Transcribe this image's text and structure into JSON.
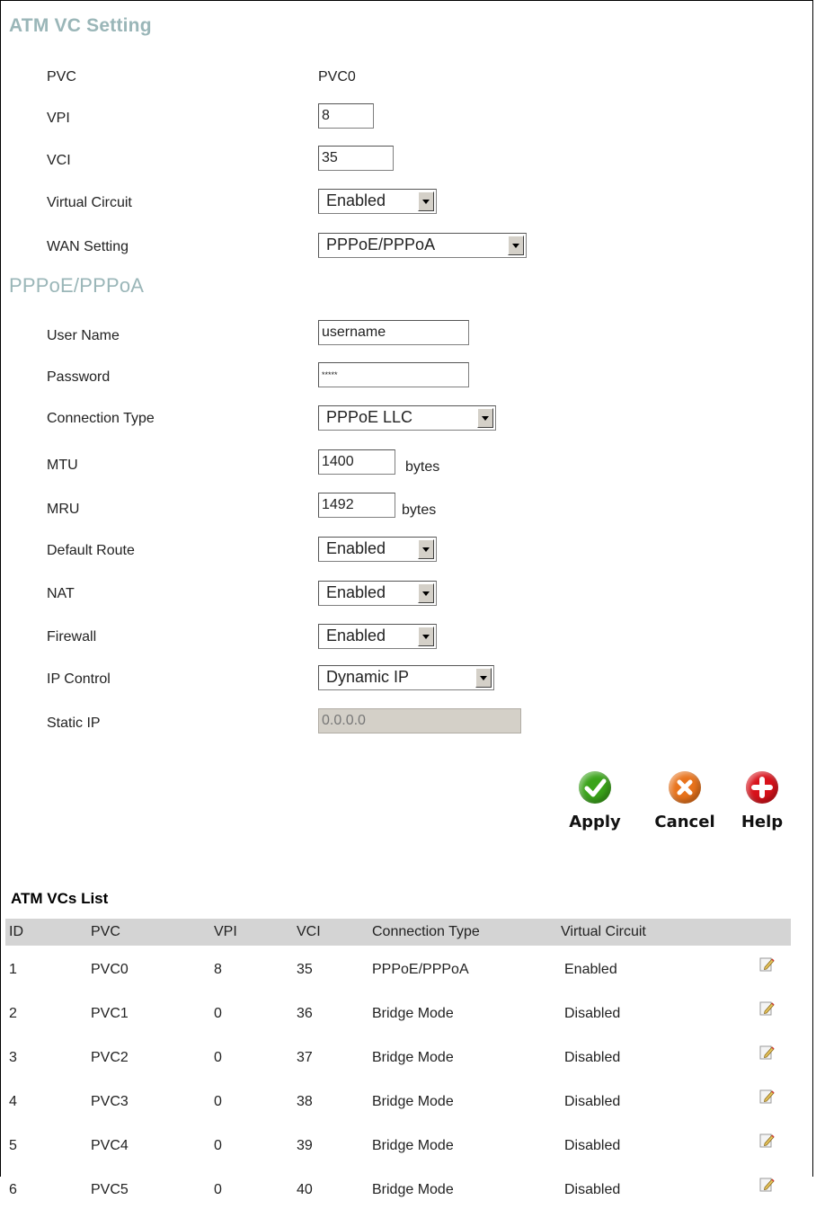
{
  "atm_vc_setting": {
    "title": "ATM VC Setting",
    "pvc": {
      "label": "PVC",
      "value": "PVC0"
    },
    "vpi": {
      "label": "VPI",
      "value": "8"
    },
    "vci": {
      "label": "VCI",
      "value": "35"
    },
    "virtual_circuit": {
      "label": "Virtual Circuit",
      "value": "Enabled"
    },
    "wan_setting": {
      "label": "WAN Setting",
      "value": "PPPoE/PPPoA"
    }
  },
  "pppoe": {
    "title": "PPPoE/PPPoA",
    "user_name": {
      "label": "User Name",
      "value": "username"
    },
    "password": {
      "label": "Password",
      "value": "*****"
    },
    "connection_type": {
      "label": "Connection Type",
      "value": "PPPoE LLC"
    },
    "mtu": {
      "label": "MTU",
      "value": "1400",
      "unit": "bytes"
    },
    "mru": {
      "label": "MRU",
      "value": "1492",
      "unit": "bytes"
    },
    "default_route": {
      "label": "Default Route",
      "value": "Enabled"
    },
    "nat": {
      "label": "NAT",
      "value": "Enabled"
    },
    "firewall": {
      "label": "Firewall",
      "value": "Enabled"
    },
    "ip_control": {
      "label": "IP Control",
      "value": "Dynamic IP"
    },
    "static_ip": {
      "label": "Static IP",
      "value": "0.0.0.0"
    }
  },
  "actions": {
    "apply": "Apply",
    "cancel": "Cancel",
    "help": "Help"
  },
  "vc_list": {
    "title": "ATM VCs List",
    "headers": {
      "id": "ID",
      "pvc": "PVC",
      "vpi": "VPI",
      "vci": "VCI",
      "connection_type": "Connection Type",
      "virtual_circuit": "Virtual Circuit"
    },
    "rows": [
      {
        "id": "1",
        "pvc": "PVC0",
        "vpi": "8",
        "vci": "35",
        "connection_type": "PPPoE/PPPoA",
        "virtual_circuit": "Enabled"
      },
      {
        "id": "2",
        "pvc": "PVC1",
        "vpi": "0",
        "vci": "36",
        "connection_type": "Bridge Mode",
        "virtual_circuit": "Disabled"
      },
      {
        "id": "3",
        "pvc": "PVC2",
        "vpi": "0",
        "vci": "37",
        "connection_type": "Bridge Mode",
        "virtual_circuit": "Disabled"
      },
      {
        "id": "4",
        "pvc": "PVC3",
        "vpi": "0",
        "vci": "38",
        "connection_type": "Bridge Mode",
        "virtual_circuit": "Disabled"
      },
      {
        "id": "5",
        "pvc": "PVC4",
        "vpi": "0",
        "vci": "39",
        "connection_type": "Bridge Mode",
        "virtual_circuit": "Disabled"
      },
      {
        "id": "6",
        "pvc": "PVC5",
        "vpi": "0",
        "vci": "40",
        "connection_type": "Bridge Mode",
        "virtual_circuit": "Disabled"
      }
    ]
  },
  "colors": {
    "section_title": "#9ab6b8",
    "apply": "#3aa31a",
    "cancel": "#e8731c",
    "help": "#d8111a",
    "table_header": "#d4d4d4"
  }
}
